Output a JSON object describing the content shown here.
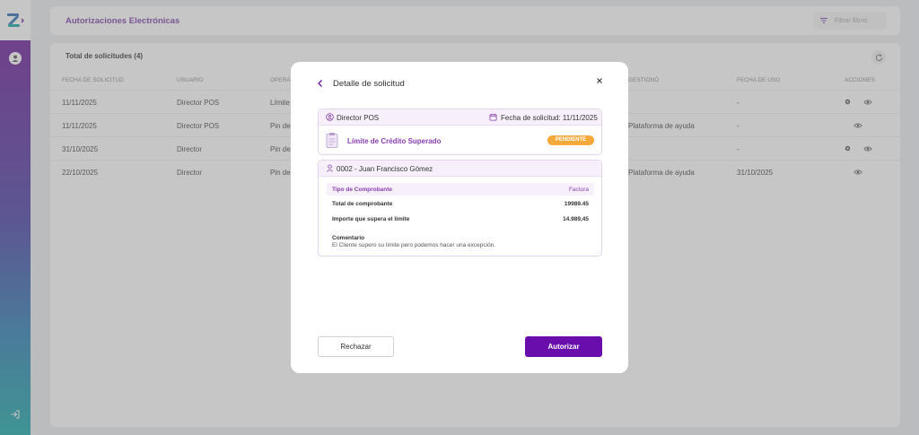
{
  "header": {
    "title": "Autorizaciones Electrónicas",
    "filter_label": "Filtrar filtros"
  },
  "table": {
    "title": "Total de solicitudes (4)",
    "columns": [
      "FECHA DE SOLICITUD",
      "USUARIO",
      "OPERA",
      "GESTIONÓ",
      "FECHA DE USO",
      "ACCIONES"
    ],
    "rows": [
      {
        "date": "11/11/2025",
        "user": "Director POS",
        "operation": "Límite d",
        "managed": "",
        "use_date": "-",
        "icons": [
          "gear",
          "eye"
        ]
      },
      {
        "date": "11/11/2025",
        "user": "Director POS",
        "operation": "Pin de s",
        "managed": "Plataforma de ayuda",
        "use_date": "-",
        "icons": [
          "eye"
        ]
      },
      {
        "date": "31/10/2025",
        "user": "Director",
        "operation": "Pin de s",
        "managed": "",
        "use_date": "-",
        "icons": [
          "gear",
          "eye"
        ]
      },
      {
        "date": "22/10/2025",
        "user": "Director",
        "operation": "Pin de s",
        "managed": "Plataforma de ayuda",
        "use_date": "31/10/2025",
        "icons": [
          "eye"
        ]
      }
    ]
  },
  "modal": {
    "title": "Detalle de solicitud",
    "user": "Director POS",
    "request_date": "Fecha de solicitud: 11/11/2025",
    "request_type": "Límite de Crédito Superado",
    "status": "PENDIENTE",
    "client": "0002 - Juan Francisco Gómez",
    "detail_header_left": "Tipo de Comprobante",
    "detail_header_right": "Factura",
    "rows": [
      {
        "label": "Total de comprobante",
        "value": "19989.45"
      },
      {
        "label": "Importe que supera el límite",
        "value": "14.989,45"
      }
    ],
    "comment_label": "Comentario",
    "comment_text": "El Cliente supero su limite pero podemos hacer una excepción.",
    "reject_label": "Rechazar",
    "approve_label": "Autorizar"
  },
  "colors": {
    "accent": "#6a0dad",
    "pending": "#f4a93a",
    "title": "#7b3fa8"
  }
}
